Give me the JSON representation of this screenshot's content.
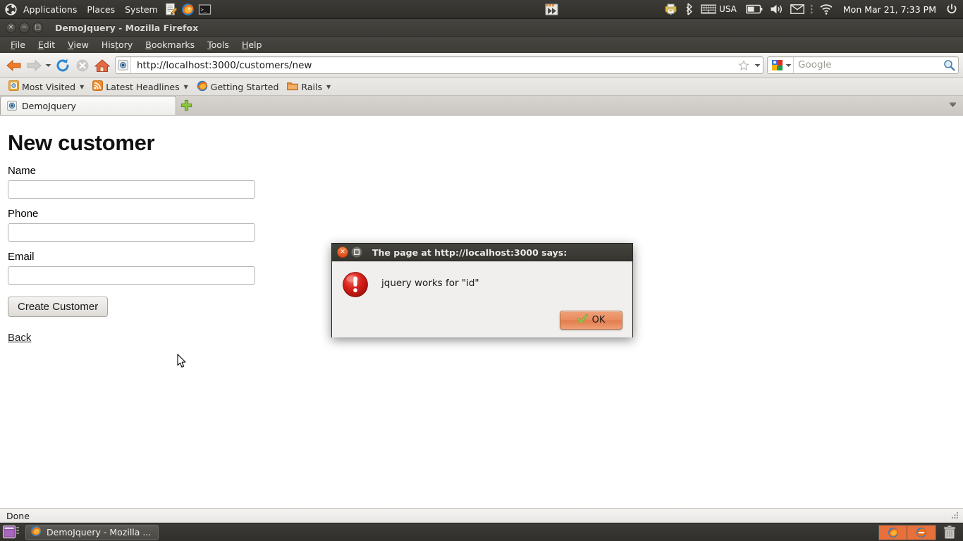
{
  "gnome_panel": {
    "logo_icon": "ubuntu-logo-icon",
    "menus": [
      {
        "label": "Applications",
        "name": "applications-menu"
      },
      {
        "label": "Places",
        "name": "places-menu"
      },
      {
        "label": "System",
        "name": "system-menu"
      }
    ],
    "launchers": [
      {
        "name": "text-editor-launcher-icon",
        "icon": "text-editor-icon"
      },
      {
        "name": "firefox-launcher-icon",
        "icon": "firefox-icon"
      },
      {
        "name": "terminal-launcher-icon",
        "icon": "terminal-icon"
      }
    ],
    "tray": {
      "window_indicator_icon": "window-list-icon",
      "printer_icon": "printer-icon",
      "bluetooth_icon": "bluetooth-icon",
      "keyboard_icon": "keyboard-icon",
      "keyboard_layout": "USA",
      "battery_icon": "battery-icon",
      "volume_icon": "volume-icon",
      "mail_icon": "envelope-icon",
      "network_icon": "wifi-icon",
      "clock": "Mon Mar 21,  7:33 PM",
      "power_icon": "power-icon"
    }
  },
  "browser": {
    "window_title": "DemoJquery - Mozilla Firefox",
    "window_buttons": [
      {
        "name": "window-close-button",
        "glyph": "×"
      },
      {
        "name": "window-minimize-button",
        "glyph": "−"
      },
      {
        "name": "window-maximize-button",
        "glyph": "□"
      }
    ],
    "menubar": [
      {
        "label": "File",
        "accel": "F"
      },
      {
        "label": "Edit",
        "accel": "E"
      },
      {
        "label": "View",
        "accel": "V"
      },
      {
        "label": "History",
        "accel": "t"
      },
      {
        "label": "Bookmarks",
        "accel": "B"
      },
      {
        "label": "Tools",
        "accel": "T"
      },
      {
        "label": "Help",
        "accel": "H"
      }
    ],
    "toolbar": {
      "back_icon": "back-arrow-icon",
      "forward_icon": "forward-arrow-icon",
      "history_dropdown_icon": "chevron-down-icon",
      "reload_icon": "reload-icon",
      "stop_icon": "stop-icon",
      "home_icon": "home-icon"
    },
    "urlbar": {
      "favicon": "page-favicon-icon",
      "url": "http://localhost:3000/customers/new",
      "star_icon": "bookmark-star-icon",
      "dropdown_icon": "chevron-down-icon"
    },
    "searchbar": {
      "engine": "Google",
      "engine_icon": "google-icon",
      "engine_dropdown_icon": "chevron-down-icon",
      "placeholder": "Google",
      "go_icon": "search-icon"
    },
    "bookmarks": [
      {
        "label": "Most Visited",
        "icon": "most-visited-icon",
        "has_caret": true
      },
      {
        "label": "Latest Headlines",
        "icon": "rss-feed-icon",
        "has_caret": true
      },
      {
        "label": "Getting Started",
        "icon": "firefox-icon",
        "has_caret": false
      },
      {
        "label": "Rails",
        "icon": "folder-icon",
        "has_caret": true
      }
    ],
    "tabs": [
      {
        "label": "DemoJquery",
        "favicon": "page-favicon-icon",
        "active": true
      }
    ],
    "new_tab_icon": "plus-icon",
    "all_tabs_icon": "chevron-down-icon",
    "statusbar": {
      "text": "Done",
      "grip_icon": "resize-grip-icon"
    }
  },
  "page": {
    "heading": "New customer",
    "fields": [
      {
        "label": "Name",
        "value": "",
        "placeholder": "",
        "name": "name-input"
      },
      {
        "label": "Phone",
        "value": "",
        "placeholder": "",
        "name": "phone-input"
      },
      {
        "label": "Email",
        "value": "",
        "placeholder": "",
        "name": "email-input"
      }
    ],
    "submit_label": "Create Customer",
    "back_link": "Back"
  },
  "dialog": {
    "title": "The page at http://localhost:3000 says:",
    "message": "jquery works for \"id\"",
    "icon": "error-alert-icon",
    "ok_label": "OK",
    "ok_icon": "green-check-icon",
    "close_button_icon": "close-icon",
    "maximize_button_icon": "maximize-icon"
  },
  "taskbar": {
    "show_desktop_icon": "show-desktop-icon",
    "windows": [
      {
        "label": "DemoJquery - Mozilla ...",
        "icon": "firefox-icon",
        "active": true
      }
    ],
    "workspaces": [
      {
        "name": "workspace-1",
        "active": true
      },
      {
        "name": "workspace-2",
        "active": true
      }
    ],
    "trash_icon": "trash-icon"
  },
  "colors": {
    "panel_bg": "#36352f",
    "ubuntu_orange": "#dd4814",
    "dialog_btn": "#e98c5e",
    "alert_red": "#c91c1c",
    "workspace_active": "#e8703a"
  }
}
